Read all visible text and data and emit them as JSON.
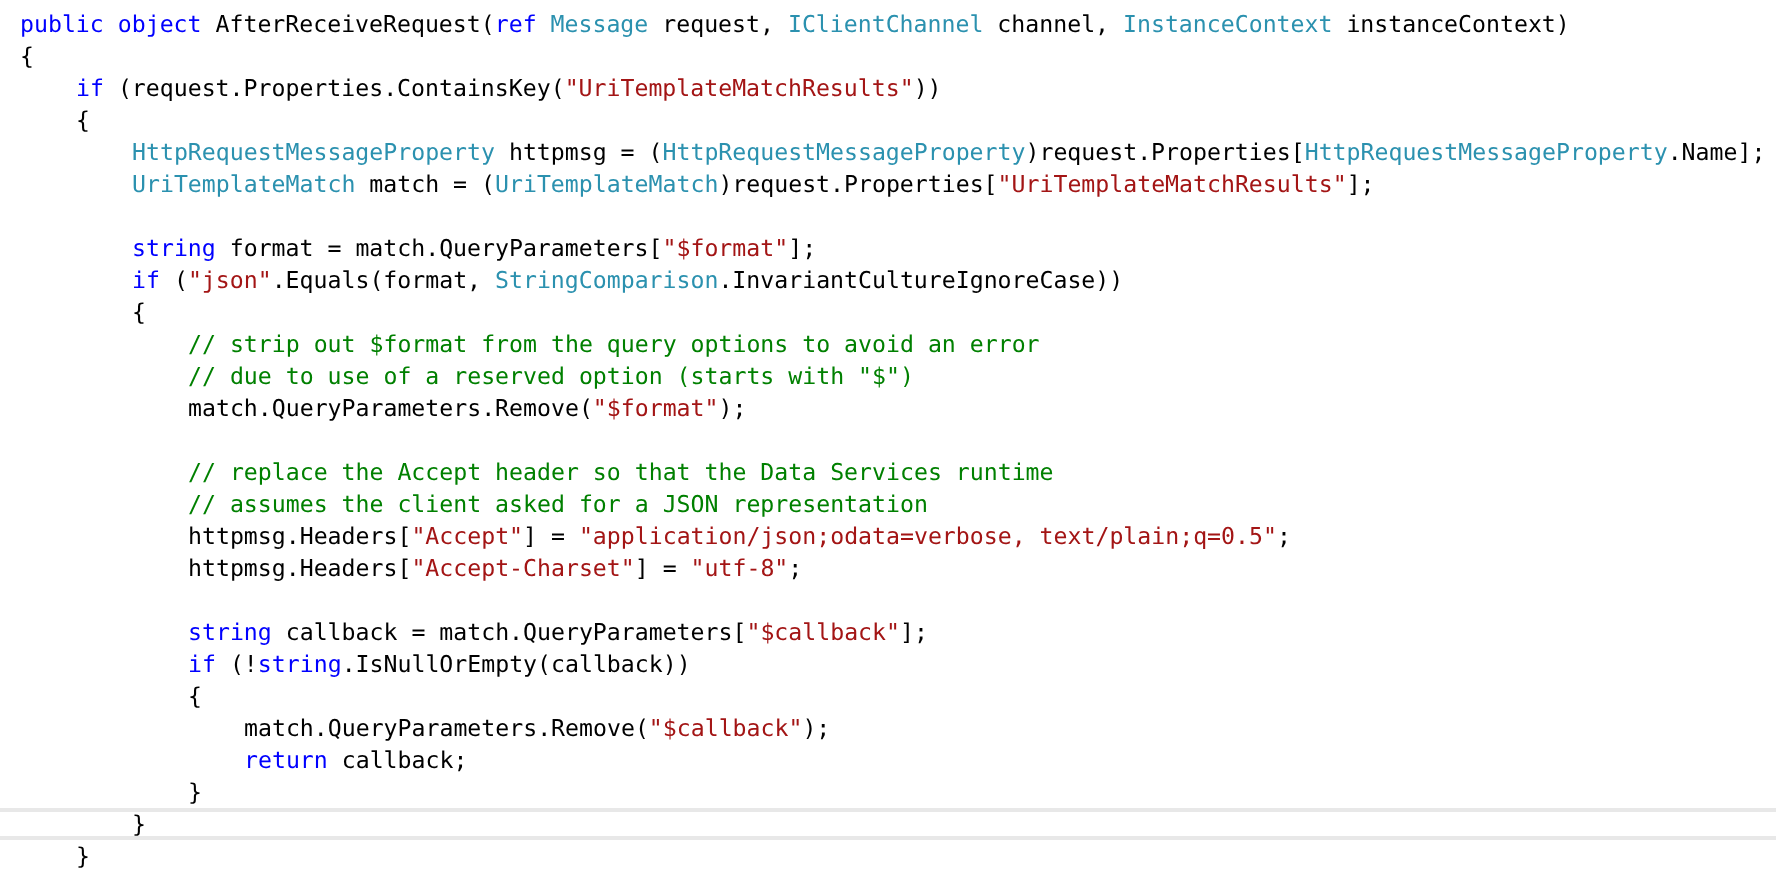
{
  "editor": {
    "lines": [
      {
        "kind": "code",
        "tokens": [
          {
            "kind": "keyword",
            "text": "public "
          },
          {
            "kind": "keyword",
            "text": "object "
          },
          {
            "kind": "plain",
            "text": "AfterReceiveRequest("
          },
          {
            "kind": "keyword",
            "text": "ref "
          },
          {
            "kind": "type",
            "text": "Message"
          },
          {
            "kind": "plain",
            "text": " request, "
          },
          {
            "kind": "type",
            "text": "IClientChannel"
          },
          {
            "kind": "plain",
            "text": " channel, "
          },
          {
            "kind": "type",
            "text": "InstanceContext"
          },
          {
            "kind": "plain",
            "text": " instanceContext)"
          }
        ]
      },
      {
        "kind": "code",
        "tokens": [
          {
            "kind": "plain",
            "text": "{"
          }
        ],
        "children": [
          {
            "kind": "code",
            "tokens": [
              {
                "kind": "keyword",
                "text": "if"
              },
              {
                "kind": "plain",
                "text": " (request.Properties.ContainsKey("
              },
              {
                "kind": "string",
                "text": "\"UriTemplateMatchResults\""
              },
              {
                "kind": "plain",
                "text": "))"
              }
            ]
          },
          {
            "kind": "code",
            "tokens": [
              {
                "kind": "plain",
                "text": "{"
              }
            ],
            "children": [
              {
                "kind": "code",
                "tokens": [
                  {
                    "kind": "type",
                    "text": "HttpRequestMessageProperty"
                  },
                  {
                    "kind": "plain",
                    "text": " httpmsg = ("
                  },
                  {
                    "kind": "type",
                    "text": "HttpRequestMessageProperty"
                  },
                  {
                    "kind": "plain",
                    "text": ")request.Properties["
                  },
                  {
                    "kind": "type",
                    "text": "HttpRequestMessageProperty"
                  },
                  {
                    "kind": "plain",
                    "text": ".Name];"
                  }
                ]
              },
              {
                "kind": "code",
                "tokens": [
                  {
                    "kind": "type",
                    "text": "UriTemplateMatch"
                  },
                  {
                    "kind": "plain",
                    "text": " match = ("
                  },
                  {
                    "kind": "type",
                    "text": "UriTemplateMatch"
                  },
                  {
                    "kind": "plain",
                    "text": ")request.Properties["
                  },
                  {
                    "kind": "string",
                    "text": "\"UriTemplateMatchResults\""
                  },
                  {
                    "kind": "plain",
                    "text": "];"
                  }
                ]
              },
              {
                "kind": "blank"
              },
              {
                "kind": "code",
                "tokens": [
                  {
                    "kind": "keyword",
                    "text": "string"
                  },
                  {
                    "kind": "plain",
                    "text": " format = match.QueryParameters["
                  },
                  {
                    "kind": "string",
                    "text": "\"$format\""
                  },
                  {
                    "kind": "plain",
                    "text": "];"
                  }
                ]
              },
              {
                "kind": "code",
                "tokens": [
                  {
                    "kind": "keyword",
                    "text": "if"
                  },
                  {
                    "kind": "plain",
                    "text": " ("
                  },
                  {
                    "kind": "string",
                    "text": "\"json\""
                  },
                  {
                    "kind": "plain",
                    "text": ".Equals(format, "
                  },
                  {
                    "kind": "type",
                    "text": "StringComparison"
                  },
                  {
                    "kind": "plain",
                    "text": ".InvariantCultureIgnoreCase))"
                  }
                ]
              },
              {
                "kind": "code",
                "tokens": [
                  {
                    "kind": "plain",
                    "text": "{"
                  }
                ],
                "children": [
                  {
                    "kind": "code",
                    "tokens": [
                      {
                        "kind": "comment",
                        "text": "// strip out $format from the query options to avoid an error"
                      }
                    ]
                  },
                  {
                    "kind": "code",
                    "tokens": [
                      {
                        "kind": "comment",
                        "text": "// due to use of a reserved option (starts with \"$\")"
                      }
                    ]
                  },
                  {
                    "kind": "code",
                    "tokens": [
                      {
                        "kind": "plain",
                        "text": "match.QueryParameters.Remove("
                      },
                      {
                        "kind": "string",
                        "text": "\"$format\""
                      },
                      {
                        "kind": "plain",
                        "text": ");"
                      }
                    ]
                  },
                  {
                    "kind": "blank"
                  },
                  {
                    "kind": "code",
                    "tokens": [
                      {
                        "kind": "comment",
                        "text": "// replace the Accept header so that the Data Services runtime"
                      }
                    ]
                  },
                  {
                    "kind": "code",
                    "tokens": [
                      {
                        "kind": "comment",
                        "text": "// assumes the client asked for a JSON representation"
                      }
                    ]
                  },
                  {
                    "kind": "code",
                    "tokens": [
                      {
                        "kind": "plain",
                        "text": "httpmsg.Headers["
                      },
                      {
                        "kind": "string",
                        "text": "\"Accept\""
                      },
                      {
                        "kind": "plain",
                        "text": "] = "
                      },
                      {
                        "kind": "string",
                        "text": "\"application/json;odata=verbose, text/plain;q=0.5\""
                      },
                      {
                        "kind": "plain",
                        "text": ";"
                      }
                    ]
                  },
                  {
                    "kind": "code",
                    "tokens": [
                      {
                        "kind": "plain",
                        "text": "httpmsg.Headers["
                      },
                      {
                        "kind": "string",
                        "text": "\"Accept-Charset\""
                      },
                      {
                        "kind": "plain",
                        "text": "] = "
                      },
                      {
                        "kind": "string",
                        "text": "\"utf-8\""
                      },
                      {
                        "kind": "plain",
                        "text": ";"
                      }
                    ]
                  },
                  {
                    "kind": "blank"
                  },
                  {
                    "kind": "code",
                    "tokens": [
                      {
                        "kind": "keyword",
                        "text": "string"
                      },
                      {
                        "kind": "plain",
                        "text": " callback = match.QueryParameters["
                      },
                      {
                        "kind": "string",
                        "text": "\"$callback\""
                      },
                      {
                        "kind": "plain",
                        "text": "];"
                      }
                    ]
                  },
                  {
                    "kind": "code",
                    "tokens": [
                      {
                        "kind": "keyword",
                        "text": "if"
                      },
                      {
                        "kind": "plain",
                        "text": " (!"
                      },
                      {
                        "kind": "keyword",
                        "text": "string"
                      },
                      {
                        "kind": "plain",
                        "text": ".IsNullOrEmpty(callback))"
                      }
                    ]
                  },
                  {
                    "kind": "code",
                    "tokens": [
                      {
                        "kind": "plain",
                        "text": "{"
                      }
                    ],
                    "children": [
                      {
                        "kind": "code",
                        "tokens": [
                          {
                            "kind": "plain",
                            "text": "match.QueryParameters.Remove("
                          },
                          {
                            "kind": "string",
                            "text": "\"$callback\""
                          },
                          {
                            "kind": "plain",
                            "text": ");"
                          }
                        ]
                      },
                      {
                        "kind": "code",
                        "tokens": [
                          {
                            "kind": "keyword",
                            "text": "return"
                          },
                          {
                            "kind": "plain",
                            "text": " callback;"
                          }
                        ]
                      }
                    ]
                  },
                  {
                    "kind": "code",
                    "tokens": [
                      {
                        "kind": "plain",
                        "text": "}"
                      }
                    ]
                  }
                ]
              },
              {
                "kind": "code",
                "current": true,
                "tokens": [
                  {
                    "kind": "plain",
                    "text": "}"
                  }
                ]
              }
            ]
          },
          {
            "kind": "code",
            "tokens": [
              {
                "kind": "plain",
                "text": "}"
              }
            ]
          }
        ]
      }
    ]
  }
}
